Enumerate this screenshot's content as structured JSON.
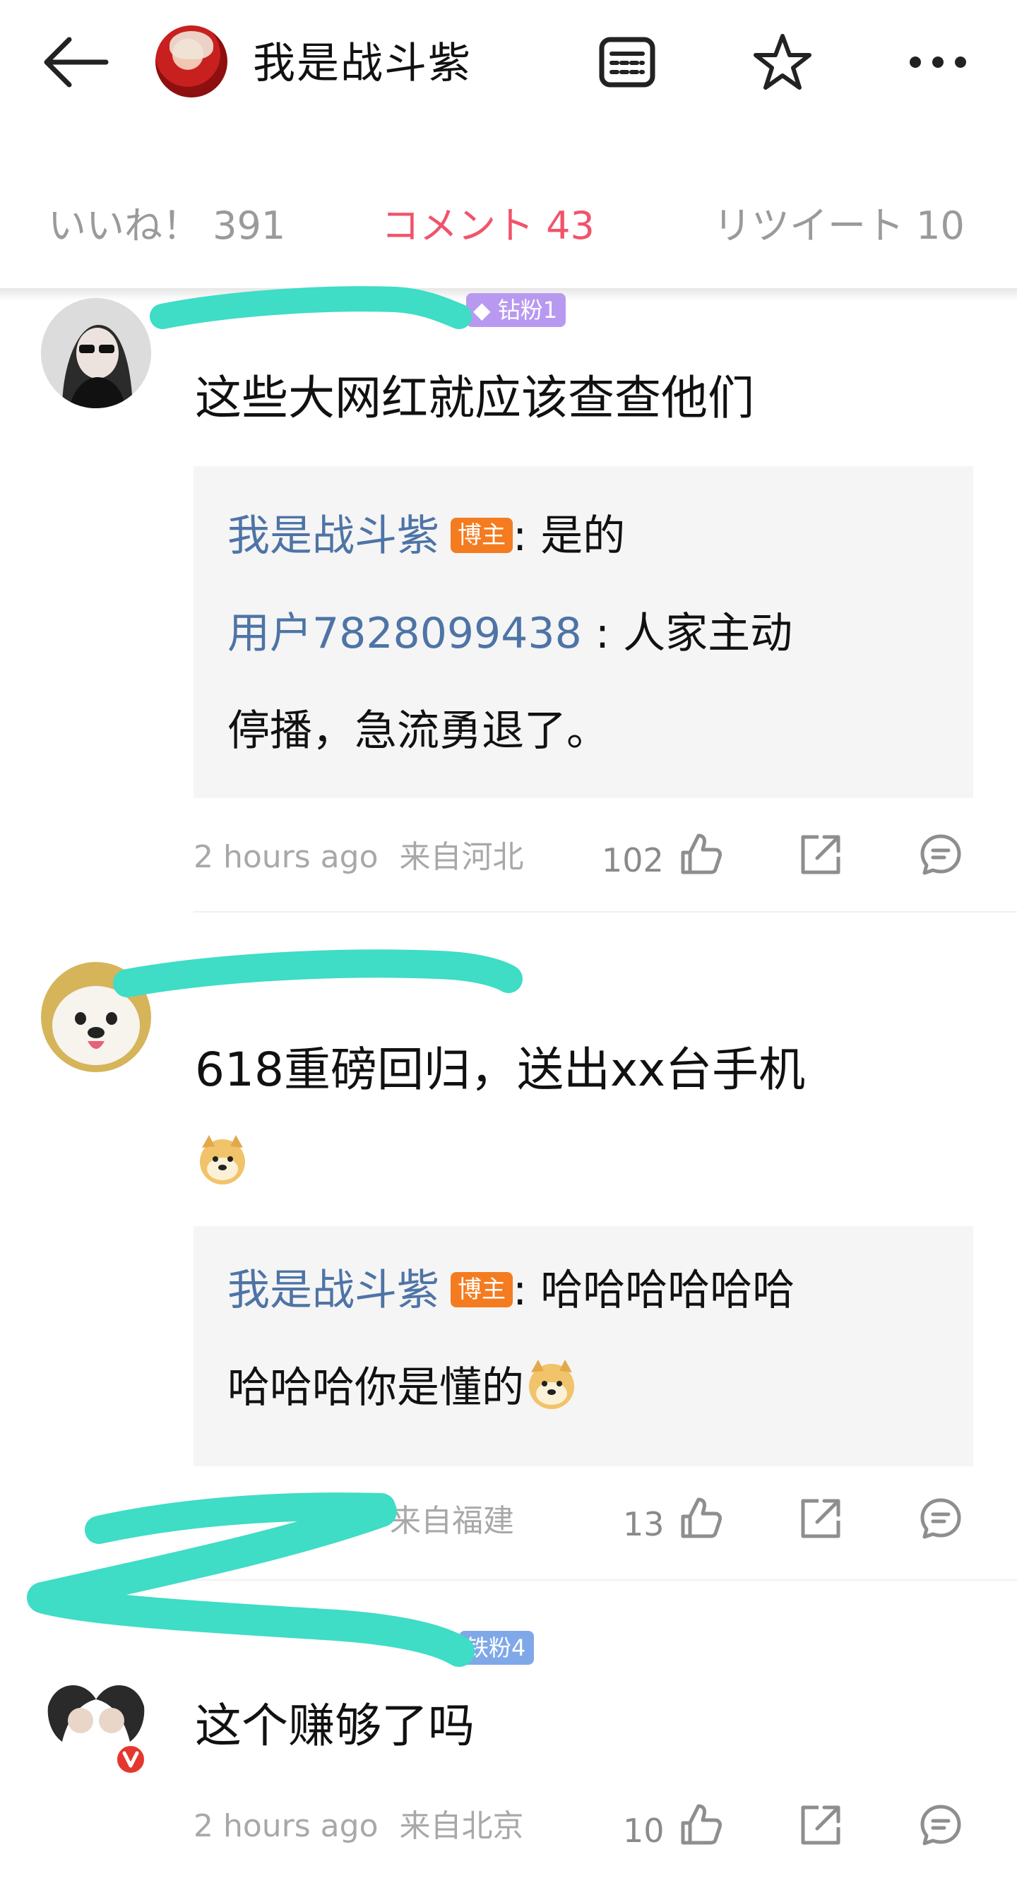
{
  "header": {
    "title": "我是战斗紫",
    "icons": [
      "back-arrow-icon",
      "document-icon",
      "star-icon",
      "more-icon"
    ]
  },
  "tabs": {
    "likes": "いいね！ 391",
    "comments": "コメント 43",
    "retweets": "リツイート 10"
  },
  "colors": {
    "accent": "#f0546a",
    "link": "#4e74a6",
    "blogger_badge": "#f47b1f",
    "redaction": "#3fdcc6"
  },
  "comments": [
    {
      "badge": "钻粉1",
      "text": "这些大网红就应该查查他们",
      "replies": [
        {
          "name": "我是战斗紫",
          "badge": "博主",
          "text": ": 是的"
        },
        {
          "name": "用户7828099438",
          "text1": " : 人家主动",
          "text2": "停播，急流勇退了。"
        }
      ],
      "time": "2 hours ago",
      "location": "来自河北",
      "likes": "102"
    },
    {
      "text1": "618重磅回归，送出xx台手机",
      "replies": [
        {
          "name": "我是战斗紫",
          "badge": "博主",
          "text1": ": 哈哈哈哈哈哈",
          "text2": "哈哈哈你是懂的"
        }
      ],
      "location": "来自福建",
      "likes": "13"
    },
    {
      "badge": "铁粉4",
      "text": "这个赚够了吗",
      "time": "2 hours ago",
      "location": "来自北京",
      "likes": "10"
    }
  ]
}
